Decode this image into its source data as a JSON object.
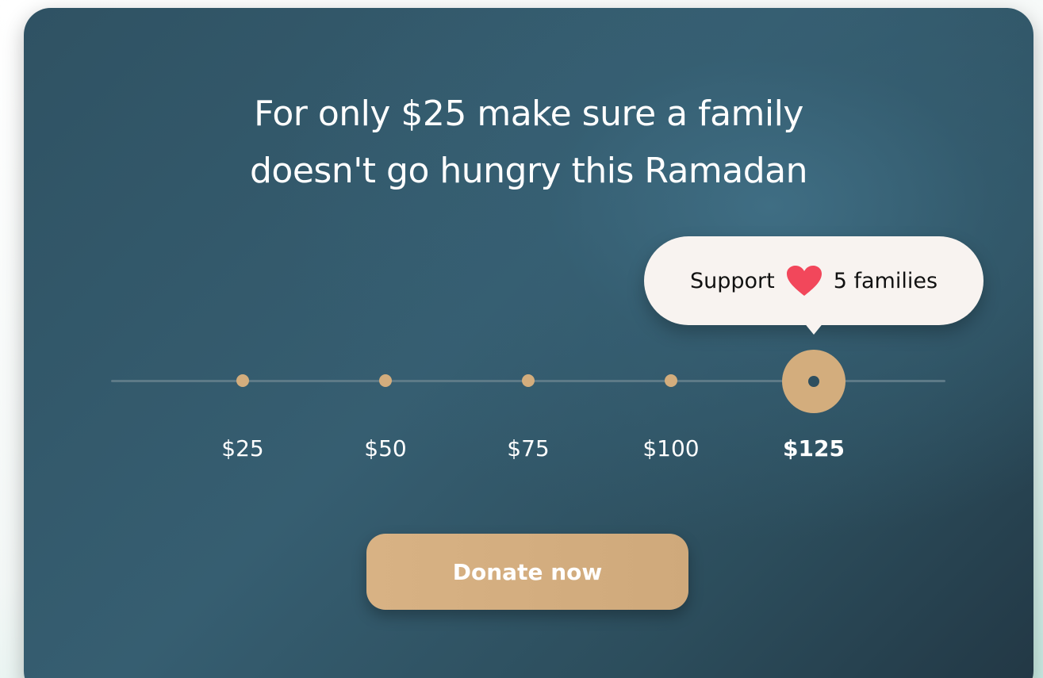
{
  "headline": {
    "line1": "For only $25 make sure a family",
    "line2": "doesn't go hungry this Ramadan"
  },
  "slider": {
    "options": [
      "$25",
      "$50",
      "$75",
      "$100",
      "$125"
    ],
    "selected_index": 4,
    "selected_value": "$125",
    "accent_color": "#d3ad7d",
    "track_color": "#5d7a87"
  },
  "tooltip": {
    "prefix": "Support",
    "icon": "heart-icon",
    "icon_color": "#f2475b",
    "suffix": "5 families"
  },
  "donate_button": {
    "label": "Donate now",
    "color": "#d3ad7d"
  },
  "colors": {
    "card_background": "#30566a",
    "text": "#ffffff"
  }
}
